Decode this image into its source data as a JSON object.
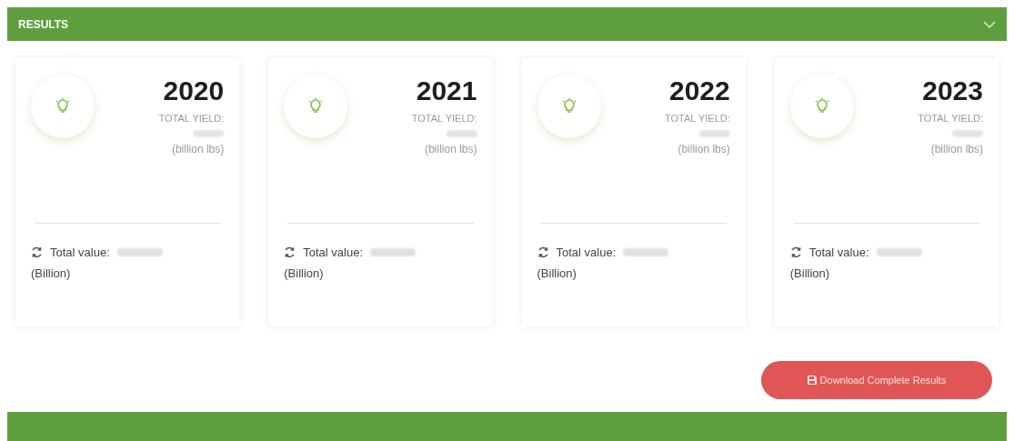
{
  "header": {
    "title": "RESULTS",
    "expanded": true
  },
  "cards": [
    {
      "year": "2020",
      "yield_label": "TOTAL YIELD:",
      "unit": "(billion lbs)",
      "value_label": "Total value:",
      "value_unit": "(Billion)"
    },
    {
      "year": "2021",
      "yield_label": "TOTAL YIELD:",
      "unit": "(billion lbs)",
      "value_label": "Total value:",
      "value_unit": "(Billion)"
    },
    {
      "year": "2022",
      "yield_label": "TOTAL YIELD:",
      "unit": "(billion lbs)",
      "value_label": "Total value:",
      "value_unit": "(Billion)"
    },
    {
      "year": "2023",
      "yield_label": "TOTAL YIELD:",
      "unit": "(billion lbs)",
      "value_label": "Total value:",
      "value_unit": "(Billion)"
    }
  ],
  "download_button": "Download Complete Results"
}
